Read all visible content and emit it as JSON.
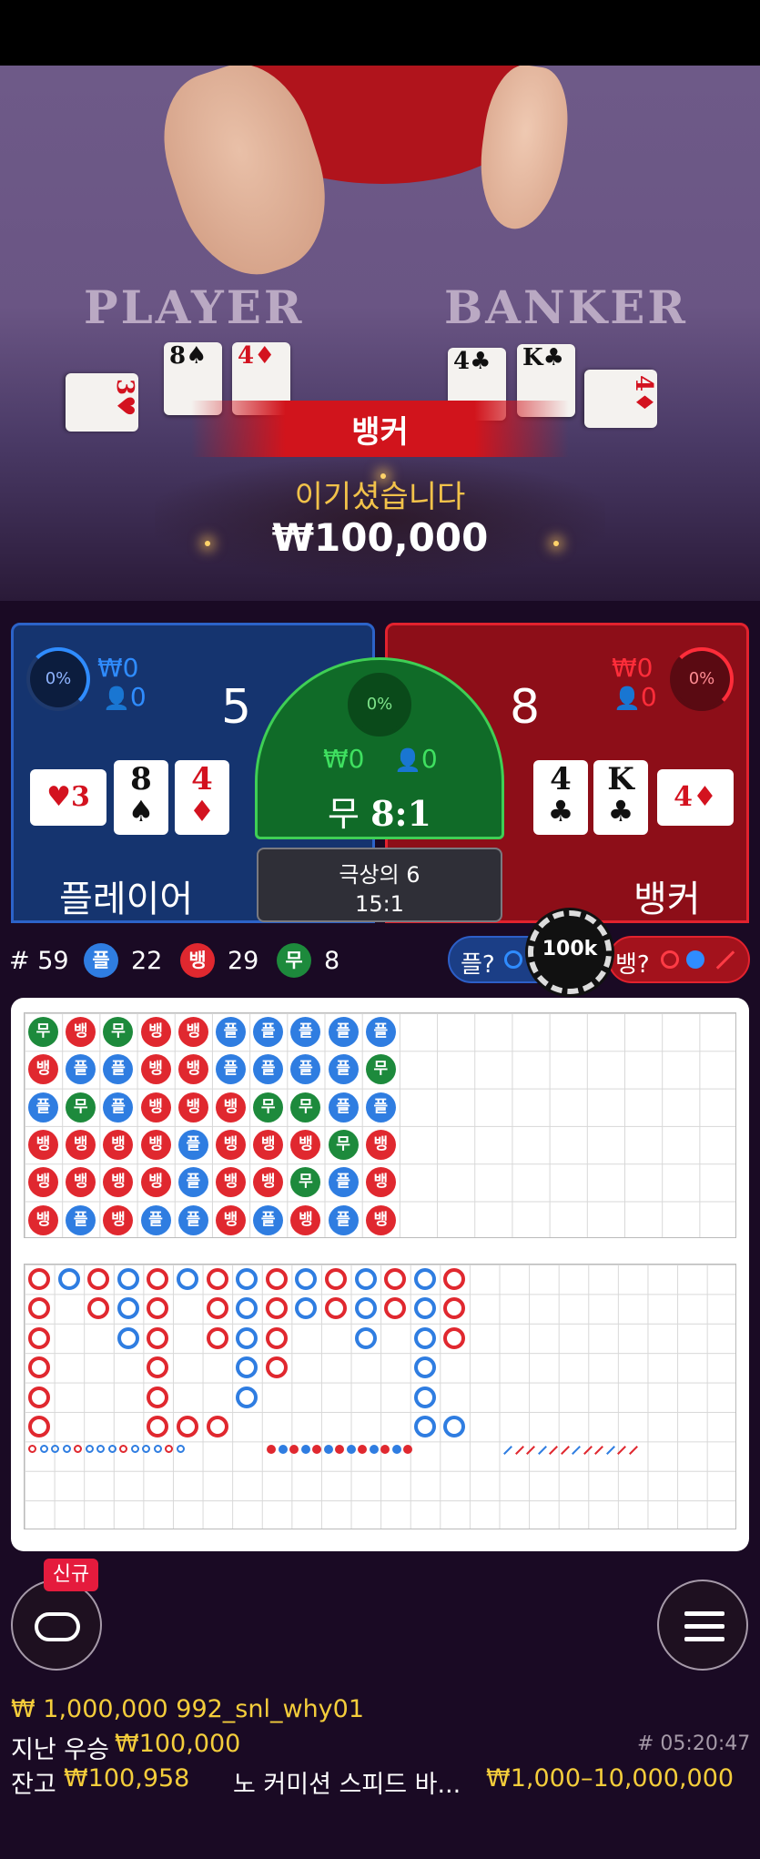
{
  "video": {
    "player_label": "PLAYER",
    "banker_label": "BANKER",
    "result_banner": "뱅커",
    "win_message": "이기셨습니다",
    "win_amount": "₩100,000",
    "player_cards": [
      {
        "rank": "3",
        "suit": "♥",
        "color": "red"
      },
      {
        "rank": "8",
        "suit": "♠",
        "color": "black"
      },
      {
        "rank": "4",
        "suit": "♦",
        "color": "red"
      }
    ],
    "banker_cards": [
      {
        "rank": "4",
        "suit": "♣",
        "color": "black"
      },
      {
        "rank": "K",
        "suit": "♣",
        "color": "black"
      },
      {
        "rank": "4",
        "suit": "♦",
        "color": "red"
      }
    ]
  },
  "player_panel": {
    "pct": "0%",
    "won": "₩0",
    "users": "0",
    "score": "5",
    "name": "플레이어",
    "side_card": {
      "rank": "3",
      "suit": "♥"
    },
    "cards": [
      {
        "rank": "8",
        "suit": "♠",
        "color": "#111"
      },
      {
        "rank": "4",
        "suit": "♦",
        "color": "#d3121f"
      }
    ]
  },
  "tie_panel": {
    "pct": "0%",
    "won": "₩0",
    "users": "0",
    "label": "무",
    "odds": "8:1",
    "side_title": "극상의 6",
    "side_odds": "15:1"
  },
  "banker_panel": {
    "pct": "0%",
    "won": "₩0",
    "users": "0",
    "score": "8",
    "name": "뱅커",
    "side_card": {
      "rank": "4",
      "suit": "♦"
    },
    "cards": [
      {
        "rank": "4",
        "suit": "♣",
        "color": "#111"
      },
      {
        "rank": "K",
        "suit": "♣",
        "color": "#111"
      }
    ]
  },
  "stats": {
    "round": "# 59",
    "player_label": "플",
    "player_count": "22",
    "banker_label": "뱅",
    "banker_count": "29",
    "tie_label": "무",
    "tie_count": "8",
    "predict_player": "플?",
    "predict_banker": "뱅?",
    "chip": "100k"
  },
  "bead_road": [
    [
      "무",
      "뱅",
      "플",
      "뱅",
      "뱅",
      "뱅"
    ],
    [
      "뱅",
      "플",
      "무",
      "뱅",
      "뱅",
      "플"
    ],
    [
      "무",
      "플",
      "플",
      "뱅",
      "뱅",
      "뱅"
    ],
    [
      "뱅",
      "뱅",
      "뱅",
      "뱅",
      "뱅",
      "플"
    ],
    [
      "뱅",
      "뱅",
      "뱅",
      "플",
      "플",
      "플"
    ],
    [
      "플",
      "플",
      "뱅",
      "뱅",
      "뱅",
      "뱅"
    ],
    [
      "플",
      "플",
      "무",
      "뱅",
      "뱅",
      "플"
    ],
    [
      "플",
      "플",
      "무",
      "뱅",
      "무",
      "뱅"
    ],
    [
      "플",
      "플",
      "플",
      "무",
      "플",
      "플"
    ],
    [
      "플",
      "무",
      "플",
      "뱅",
      "뱅",
      "뱅"
    ]
  ],
  "colors": {
    "player": "#2f7de1",
    "banker": "#e0282f",
    "tie": "#1d8a3c",
    "gold": "#f4cd3b"
  },
  "footer": {
    "balance_line": "₩ 1,000,000 992_snl_why01",
    "last_win_label": "지난 우승",
    "last_win_amount": "₩100,000",
    "game_id": "# 05:20:47",
    "balance_label": "잔고",
    "balance_amount": "₩100,958",
    "table_name": "노 커미션 스피드 바...",
    "limits": "₩1,000–10,000,000",
    "new_badge": "신규"
  },
  "icons": [
    "chat-bubble-icon",
    "hamburger-menu-icon",
    "person-icon",
    "chip-icon"
  ]
}
